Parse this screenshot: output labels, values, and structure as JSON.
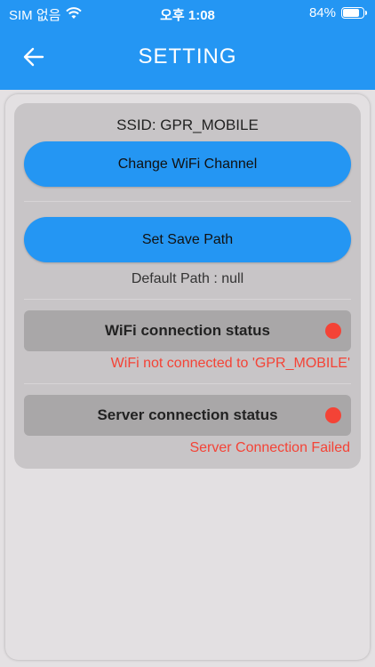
{
  "status_bar": {
    "carrier": "SIM 없음",
    "time": "오후 1:08",
    "battery": "84%",
    "battery_level": 0.84
  },
  "header": {
    "title": "SETTING"
  },
  "ssid_text": "SSID: GPR_MOBILE",
  "buttons": {
    "change_wifi": "Change WiFi Channel",
    "set_save_path": "Set Save Path"
  },
  "default_path": "Default Path : null",
  "wifi_status": {
    "label": "WiFi connection status",
    "message": "WiFi not connected to 'GPR_MOBILE'"
  },
  "server_status": {
    "label": "Server connection status",
    "message": "Server Connection Failed"
  },
  "colors": {
    "accent": "#2496f3",
    "error": "#f44336"
  }
}
